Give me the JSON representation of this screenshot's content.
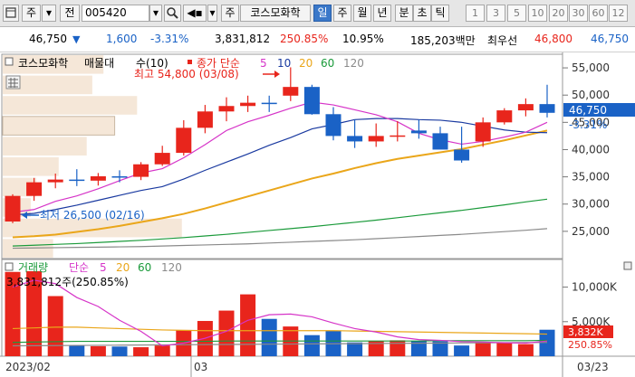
{
  "toolbar": {
    "market": "주",
    "prefix": "전",
    "code": "005420",
    "name_tab": "주",
    "stock_name": "코스모화학",
    "period_buttons": [
      "일",
      "주",
      "월",
      "년",
      "분",
      "초",
      "틱"
    ],
    "active_period": "일",
    "tick_numbers": [
      "1",
      "3",
      "5",
      "10",
      "20",
      "30",
      "60",
      "12"
    ]
  },
  "quote": {
    "price": "46,750",
    "change_arrow": "▼",
    "change": "1,600",
    "change_rate": "-3.31%",
    "volume": "3,831,812",
    "volume_ratio": "250.85%",
    "turnover_rate": "10.95%",
    "trade_value": "185,203백만",
    "best_label": "최우선",
    "bid": "46,800",
    "ask": "46,750"
  },
  "price_panel": {
    "stock_label": "코스모화학",
    "indicator_label": "매물대",
    "indicator_count": "수(10)",
    "ma_label": "종가 단순",
    "ma_periods": [
      "5",
      "10",
      "20",
      "60",
      "120"
    ],
    "high_annotation": "최고 54,800 (03/08)",
    "low_annotation": "최저 26,500 (02/16)",
    "axis_ticks": [
      "55,000",
      "50,000",
      "45,000",
      "40,000",
      "35,000",
      "30,000",
      "25,000"
    ],
    "current_price_tag": "46,750",
    "current_change_tag": "-3.31%"
  },
  "volume_panel": {
    "label": "거래량",
    "ma_label": "단순",
    "ma_periods": [
      "5",
      "20",
      "60",
      "120"
    ],
    "info": "3,831,812주(250.85%)",
    "axis_ticks": [
      "10,000K",
      "5,000K"
    ],
    "current_volume_tag": "3,832K",
    "current_ratio_tag": "250.85%"
  },
  "x_axis": {
    "labels": [
      "2023/02",
      "03",
      "03/23"
    ]
  },
  "colors": {
    "up": "#e8251c",
    "down": "#1a62c6",
    "ma5": "#d634c8",
    "ma10": "#1a3aa0",
    "ma20": "#eaa61a",
    "ma60": "#1a9a3a",
    "ma120": "#8a8a8a"
  },
  "chart_data": {
    "type": "candlestick",
    "x": [
      "02/15",
      "02/16",
      "02/17",
      "02/20",
      "02/21",
      "02/22",
      "02/23",
      "02/24",
      "02/27",
      "02/28",
      "03/02",
      "03/03",
      "03/06",
      "03/07",
      "03/08",
      "03/09",
      "03/10",
      "03/13",
      "03/14",
      "03/15",
      "03/16",
      "03/17",
      "03/20",
      "03/21",
      "03/22",
      "03/23"
    ],
    "open": [
      26800,
      31500,
      34000,
      34500,
      34300,
      35100,
      35000,
      37300,
      39400,
      44000,
      47000,
      48000,
      48600,
      49900,
      51500,
      46500,
      42500,
      41500,
      42500,
      43500,
      43000,
      40000,
      41500,
      45000,
      47200,
      48350
    ],
    "high": [
      31800,
      34800,
      35600,
      36400,
      35700,
      36200,
      37700,
      40700,
      45400,
      48200,
      49600,
      49900,
      49900,
      55100,
      51900,
      47800,
      45500,
      44800,
      45200,
      45500,
      44200,
      44200,
      45900,
      47600,
      49400,
      51900
    ],
    "low": [
      26500,
      30600,
      32900,
      33300,
      33400,
      34000,
      34400,
      37000,
      38900,
      43000,
      45200,
      46900,
      46900,
      48900,
      46400,
      41700,
      40300,
      40500,
      41500,
      42000,
      40200,
      37600,
      40500,
      44600,
      46100,
      45900
    ],
    "close": [
      31500,
      34000,
      34500,
      34300,
      35100,
      35000,
      37300,
      39400,
      44000,
      47000,
      48000,
      48600,
      48350,
      51500,
      46500,
      42500,
      41500,
      42500,
      42600,
      43000,
      40000,
      38000,
      45000,
      47200,
      48350,
      46750
    ],
    "ma5": [
      28500,
      29000,
      30500,
      31500,
      32800,
      34300,
      35700,
      36500,
      38500,
      40900,
      43500,
      45100,
      46300,
      47600,
      48700,
      48200,
      47300,
      46400,
      45100,
      43000,
      41800,
      41000,
      41500,
      42300,
      43200,
      45000
    ],
    "ma10": [
      28000,
      28300,
      29000,
      29800,
      30700,
      31600,
      32500,
      33200,
      34600,
      36200,
      37700,
      39200,
      40800,
      42200,
      43800,
      44600,
      45500,
      45700,
      45700,
      45500,
      45400,
      45000,
      44300,
      43600,
      43200,
      43100
    ],
    "ma20": [
      23900,
      24100,
      24400,
      24900,
      25400,
      26000,
      26700,
      27400,
      28200,
      29200,
      30300,
      31400,
      32500,
      33600,
      34700,
      35600,
      36600,
      37500,
      38300,
      38900,
      39500,
      40100,
      40900,
      41700,
      42600,
      43500
    ],
    "ma60": [
      22300,
      22450,
      22600,
      22750,
      22950,
      23150,
      23350,
      23600,
      23850,
      24150,
      24450,
      24800,
      25150,
      25500,
      25850,
      26250,
      26650,
      27050,
      27500,
      27950,
      28400,
      28850,
      29350,
      29850,
      30400,
      30900
    ],
    "ma120": [
      21900,
      21950,
      22000,
      22050,
      22100,
      22150,
      22200,
      22300,
      22400,
      22500,
      22600,
      22700,
      22850,
      23000,
      23150,
      23300,
      23450,
      23650,
      23850,
      24050,
      24250,
      24450,
      24700,
      24950,
      25200,
      25500
    ],
    "volume_k": [
      12200,
      12300,
      8700,
      1550,
      1450,
      1400,
      1300,
      1550,
      3800,
      5100,
      6600,
      8950,
      5400,
      4300,
      3050,
      3700,
      2000,
      2200,
      2300,
      2200,
      2150,
      1550,
      2050,
      1900,
      1750,
      3832
    ],
    "vol_ma5_k": [
      10000,
      11000,
      10500,
      8500,
      7200,
      5200,
      3600,
      1500,
      1900,
      2600,
      3600,
      5200,
      6000,
      6100,
      5700,
      4800,
      4000,
      3500,
      2800,
      2400,
      2300,
      2100,
      2050,
      1950,
      1900,
      2200
    ],
    "vol_ma20_k": [
      4000,
      4100,
      4200,
      4200,
      4100,
      4000,
      3900,
      3800,
      3750,
      3700,
      3700,
      3700,
      3700,
      3700,
      3700,
      3700,
      3650,
      3600,
      3550,
      3500,
      3450,
      3400,
      3350,
      3300,
      3250,
      3200
    ],
    "vol_ma60_k": [
      2000,
      2050,
      2100,
      2150,
      2150,
      2150,
      2150,
      2150,
      2150,
      2150,
      2200,
      2200,
      2200,
      2200,
      2200,
      2200,
      2200,
      2200,
      2200,
      2200,
      2250,
      2250,
      2250,
      2250,
      2250,
      2300
    ],
    "vol_ma120_k": [
      1500,
      1520,
      1540,
      1560,
      1580,
      1600,
      1620,
      1640,
      1660,
      1680,
      1700,
      1720,
      1740,
      1760,
      1780,
      1800,
      1820,
      1840,
      1860,
      1880,
      1900,
      1920,
      1940,
      1960,
      1980,
      2000
    ],
    "volume_profile": [
      0.18,
      0.16,
      0.24,
      0.2,
      0.15,
      0.1,
      0.06,
      0.05,
      0.32,
      0.09
    ],
    "ylim": [
      20000,
      57500
    ],
    "volume_ylim": [
      0,
      14000
    ]
  }
}
